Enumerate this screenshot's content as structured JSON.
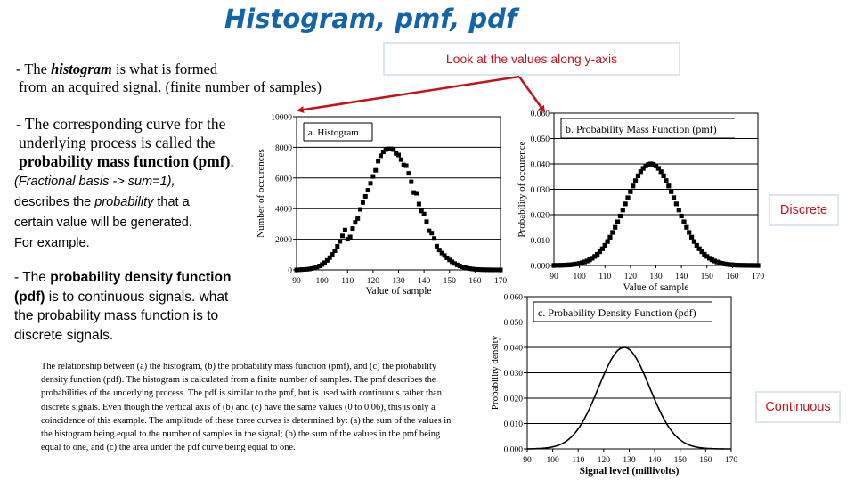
{
  "slide": {
    "title": "Histogram, pmf, pdf",
    "intro": {
      "dash": "- The ",
      "term": "histogram",
      "rest1": " is what is formed",
      "line2": "from an acquired signal. (finite number of samples)"
    },
    "pmf_text": {
      "line1": "- The corresponding curve for the",
      "line2": "underlying process is called the",
      "line3": "probability mass function (pmf)",
      "line3_end": "."
    },
    "pmf_note": {
      "line1": "(Fractional basis -> sum=1),",
      "line2_a": "describes the ",
      "line2_em": "probability",
      "line2_b": " that a",
      "line3": "certain value will be generated.",
      "line4": "For example."
    },
    "pdf_text": {
      "dash": "- The ",
      "term": "probability density function",
      "line2_term": "(pdf)",
      "line2_rest": " is to continuous signals. what",
      "line3": "the probability mass function is to",
      "line4": "discrete signals."
    },
    "caption": "The relationship between (a) the histogram, (b) the probability mass function (pmf), and (c) the probability density function (pdf). The histogram is calculated from a finite number of samples. The pmf describes the probabilities of the underlying process. The pdf is similar to the pmf, but is used with continuous rather than discrete signals. Even though the vertical axis of (b) and (c) have the same values (0 to 0.06), this is only a coincidence of this example. The amplitude of these three curves is determined by: (a) the sum of the values in the histogram being equal to the number of samples in the signal; (b) the sum of the values in the pmf being equal to one, and (c) the area under the pdf curve being equal to one.",
    "callouts": {
      "yaxis": "Look at the values along y-axis",
      "discrete": "Discrete",
      "continuous": "Continuous"
    },
    "colors": {
      "title": "#1464a8",
      "callout_text": "#c0141c",
      "callout_border": "#dde6ef",
      "arrow": "#c0141c"
    }
  },
  "chart_data": [
    {
      "type": "scatter",
      "title": "a.  Histogram",
      "xlabel": "Value of sample",
      "ylabel": "Number of occurences",
      "xlim": [
        90,
        170
      ],
      "ylim": [
        0,
        10000
      ],
      "xticks": [
        "90",
        "100",
        "110",
        "120",
        "130",
        "140",
        "150",
        "160",
        "170"
      ],
      "yticks": [
        "0",
        "2000",
        "4000",
        "6000",
        "8000",
        "10000"
      ],
      "grid": "horizontal",
      "x": [
        90,
        91,
        92,
        93,
        94,
        95,
        96,
        97,
        98,
        99,
        100,
        101,
        102,
        103,
        104,
        105,
        106,
        107,
        108,
        109,
        110,
        111,
        112,
        113,
        114,
        115,
        116,
        117,
        118,
        119,
        120,
        121,
        122,
        123,
        124,
        125,
        126,
        127,
        128,
        129,
        130,
        131,
        132,
        133,
        134,
        135,
        136,
        137,
        138,
        139,
        140,
        141,
        142,
        143,
        144,
        145,
        146,
        147,
        148,
        149,
        150,
        151,
        152,
        153,
        154,
        155,
        156,
        157,
        158,
        159,
        160,
        161,
        162,
        163,
        164,
        165,
        166,
        167,
        168,
        169,
        170
      ],
      "y": [
        0,
        10,
        20,
        30,
        40,
        60,
        90,
        130,
        190,
        260,
        350,
        470,
        620,
        800,
        1010,
        1250,
        1540,
        1860,
        2220,
        2600,
        2000,
        2150,
        2700,
        3100,
        3350,
        3950,
        4400,
        4800,
        5200,
        5650,
        6100,
        6500,
        7100,
        7450,
        7700,
        7850,
        7900,
        7900,
        7850,
        7600,
        7500,
        7200,
        6850,
        6800,
        6300,
        5750,
        5050,
        5000,
        4300,
        3850,
        3650,
        3150,
        2550,
        2400,
        2050,
        1550,
        1300,
        1100,
        940,
        790,
        650,
        530,
        420,
        330,
        260,
        200,
        150,
        110,
        80,
        60,
        40,
        30,
        20,
        15,
        10,
        8,
        5,
        3,
        2,
        1,
        0
      ]
    },
    {
      "type": "scatter",
      "title": "b.  Probability Mass Function (pmf)",
      "xlabel": "Value of sample",
      "ylabel": "Probability of occurence",
      "xlim": [
        90,
        170
      ],
      "ylim": [
        0,
        0.06
      ],
      "xticks": [
        "90",
        "100",
        "110",
        "120",
        "130",
        "140",
        "150",
        "160",
        "170"
      ],
      "yticks": [
        "0.000",
        "0.010",
        "0.020",
        "0.030",
        "0.040",
        "0.050",
        "0.060"
      ],
      "grid": "horizontal",
      "distribution": {
        "kind": "gaussian",
        "mean": 128,
        "sigma": 10,
        "peak": 0.04,
        "step": 1
      }
    },
    {
      "type": "line",
      "title": "c.  Probability Density Function (pdf)",
      "xlabel": "Signal level (millivolts)",
      "ylabel": "Probability density",
      "xlim": [
        90,
        170
      ],
      "ylim": [
        0,
        0.06
      ],
      "xticks": [
        "90",
        "100",
        "110",
        "120",
        "130",
        "140",
        "150",
        "160",
        "170"
      ],
      "yticks": [
        "0.000",
        "0.010",
        "0.020",
        "0.030",
        "0.040",
        "0.050",
        "0.060"
      ],
      "grid": "horizontal",
      "distribution": {
        "kind": "gaussian",
        "mean": 128,
        "sigma": 10,
        "peak": 0.04
      }
    }
  ]
}
